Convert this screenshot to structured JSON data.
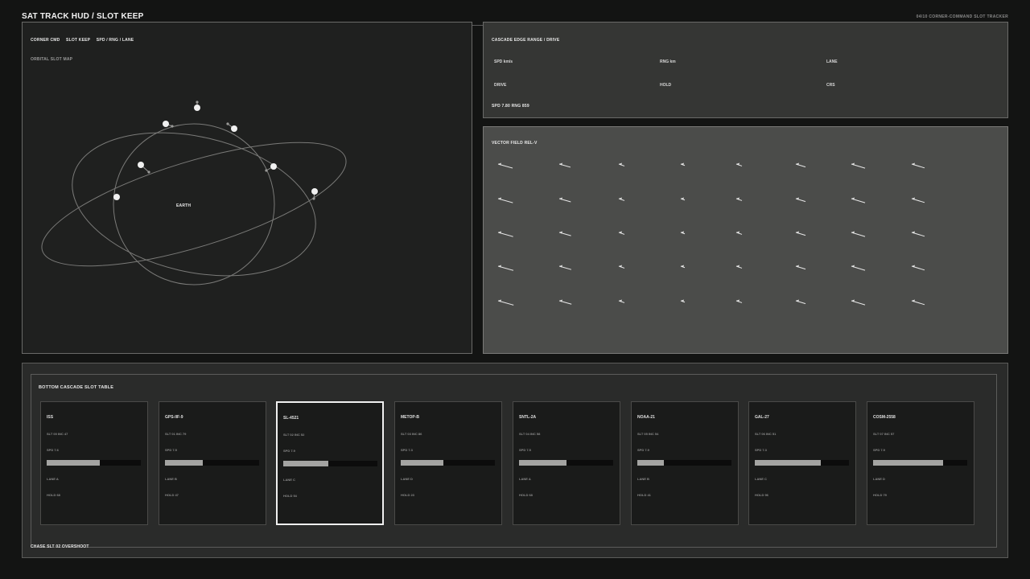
{
  "header": {
    "title": "SAT TRACK HUD  /  SLOT KEEP",
    "right": "04/10  CORNER-COMMAND SLOT TRACKER"
  },
  "left_panel": {
    "tabs": [
      "CORNER CMD",
      "SLOT KEEP",
      "SPD / RNG / LANE"
    ],
    "map_label": "ORBITAL SLOT MAP",
    "earth_label": "EARTH"
  },
  "cascade": {
    "title": "CASCADE EDGE  RANGE / DRIVE",
    "row1": [
      "SPD km/s",
      "RNG km",
      "LANE"
    ],
    "row2": [
      "DRIVE",
      "HOLD",
      "CRS"
    ],
    "readout": "SPD 7.80  RNG 859"
  },
  "vector": {
    "title": "VECTOR FIELD  REL-V"
  },
  "bottom": {
    "title": "BOTTOM CASCADE  SLOT TABLE",
    "footer": "CHASE SLT 02  OVERSHOOT",
    "cards": [
      {
        "name": "ISS",
        "slot": "SLT 00  INC 47",
        "spd": "SPD 7.6",
        "bar": 0.56,
        "lane": "LANE A",
        "hold": "HOLD 68"
      },
      {
        "name": "GPS-IIF-9",
        "slot": "SLT 01  INC 79",
        "spd": "SPD 7.5",
        "bar": 0.4,
        "lane": "LANE B",
        "hold": "HOLD 47"
      },
      {
        "name": "SL-4521",
        "slot": "SLT 02  INC 52",
        "spd": "SPD 7.9",
        "bar": 0.48,
        "lane": "LANE C",
        "hold": "HOLD 54",
        "selected": true
      },
      {
        "name": "METOP-B",
        "slot": "SLT 03  INC 86",
        "spd": "SPD 7.3",
        "bar": 0.45,
        "lane": "LANE D",
        "hold": "HOLD 23"
      },
      {
        "name": "SNTL-2A",
        "slot": "SLT 04  INC 58",
        "spd": "SPD 7.5",
        "bar": 0.5,
        "lane": "LANE A",
        "hold": "HOLD 68"
      },
      {
        "name": "NOAA-21",
        "slot": "SLT 05  INC 54",
        "spd": "SPD 7.9",
        "bar": 0.28,
        "lane": "LANE B",
        "hold": "HOLD 41"
      },
      {
        "name": "GAL-27",
        "slot": "SLT 06  INC 51",
        "spd": "SPD 7.3",
        "bar": 0.7,
        "lane": "LANE C",
        "hold": "HOLD 96"
      },
      {
        "name": "COSM-2558",
        "slot": "SLT 07  INC 57",
        "spd": "SPD 7.9",
        "bar": 0.74,
        "lane": "LANE D",
        "hold": "HOLD 79"
      }
    ]
  }
}
